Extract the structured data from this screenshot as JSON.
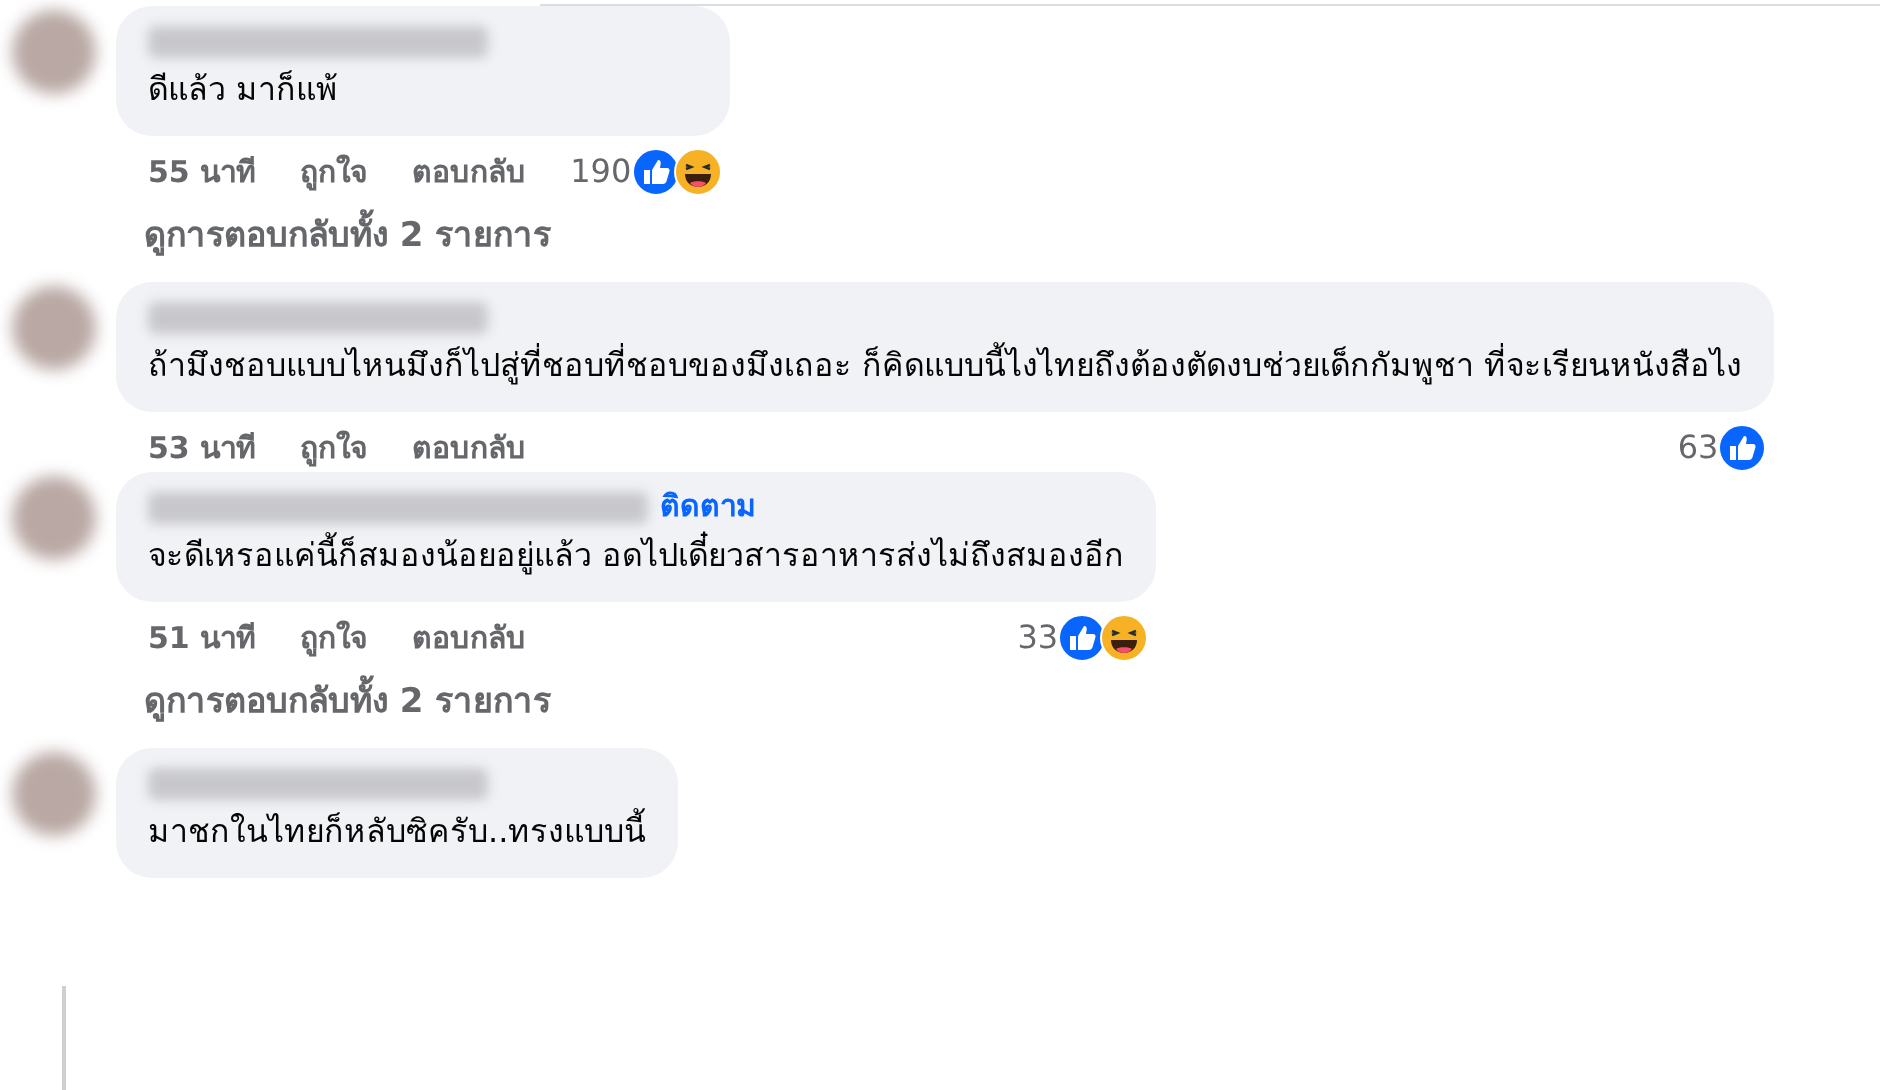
{
  "thread": [
    {
      "kind": "comment",
      "text": "ดีแล้ว มาก็แพ้",
      "time": "55 นาที",
      "like": "ถูกใจ",
      "reply": "ตอบกลับ",
      "reaction_count": "190",
      "reactions": [
        {
          "kind": "like"
        },
        {
          "kind": "haha"
        }
      ]
    },
    {
      "kind": "view_replies",
      "text": "ดูการตอบกลับทั้ง 2 รายการ"
    },
    {
      "kind": "comment",
      "text": "ถ้ามึงชอบแบบไหนมึงก็ไปสู่ที่ชอบที่ชอบของมึงเถอะ ก็คิดแบบนี้ไงไทยถึงต้องตัดงบช่วยเด็กกัมพูชา ที่จะเรียนหนังสือไง",
      "time": "53 นาที",
      "like": "ถูกใจ",
      "reply": "ตอบกลับ",
      "reaction_count": "63",
      "reactions": [
        {
          "kind": "like"
        }
      ]
    },
    {
      "kind": "comment",
      "follow": "ติดตาม",
      "text": "จะดีเหรอแค่นี้ก็สมองน้อยอยู่แล้ว อดไปเดี๋ยวสารอาหารส่งไม่ถึงสมองอีก",
      "time": "51 นาที",
      "like": "ถูกใจ",
      "reply": "ตอบกลับ",
      "reaction_count": "33",
      "reactions": [
        {
          "kind": "like"
        },
        {
          "kind": "haha"
        }
      ]
    },
    {
      "kind": "view_replies",
      "text": "ดูการตอบกลับทั้ง 2 รายการ"
    },
    {
      "kind": "comment",
      "text": "มาชกในไทยก็หลับซิครับ..ทรงแบบนี้"
    }
  ]
}
